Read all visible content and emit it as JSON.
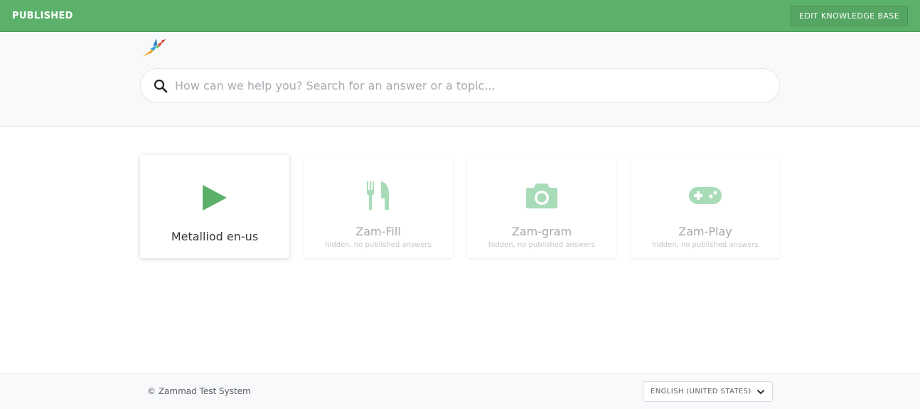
{
  "topbar": {
    "status": "PUBLISHED",
    "edit_label": "EDIT KNOWLEDGE BASE",
    "color": "#5bb06a"
  },
  "header": {
    "logo_icon": "bird-logo-icon",
    "search": {
      "placeholder": "How can we help you? Search for an answer or a topic..."
    }
  },
  "categories": [
    {
      "title": "Metalliod en-us",
      "subtitle": "",
      "icon": "play-icon",
      "icon_color": "#5bb06a"
    },
    {
      "title": "Zam-Fill",
      "subtitle": "hidden, no published answers",
      "icon": "utensils-icon",
      "icon_color": "#a8dcb9"
    },
    {
      "title": "Zam-gram",
      "subtitle": "hidden, no published answers",
      "icon": "camera-icon",
      "icon_color": "#a8dcb9"
    },
    {
      "title": "Zam-Play",
      "subtitle": "hidden, no published answers",
      "icon": "gamepad-icon",
      "icon_color": "#a8dcb9"
    }
  ],
  "footer": {
    "copyright": "© Zammad Test System",
    "language": "ENGLISH (UNITED STATES)"
  }
}
